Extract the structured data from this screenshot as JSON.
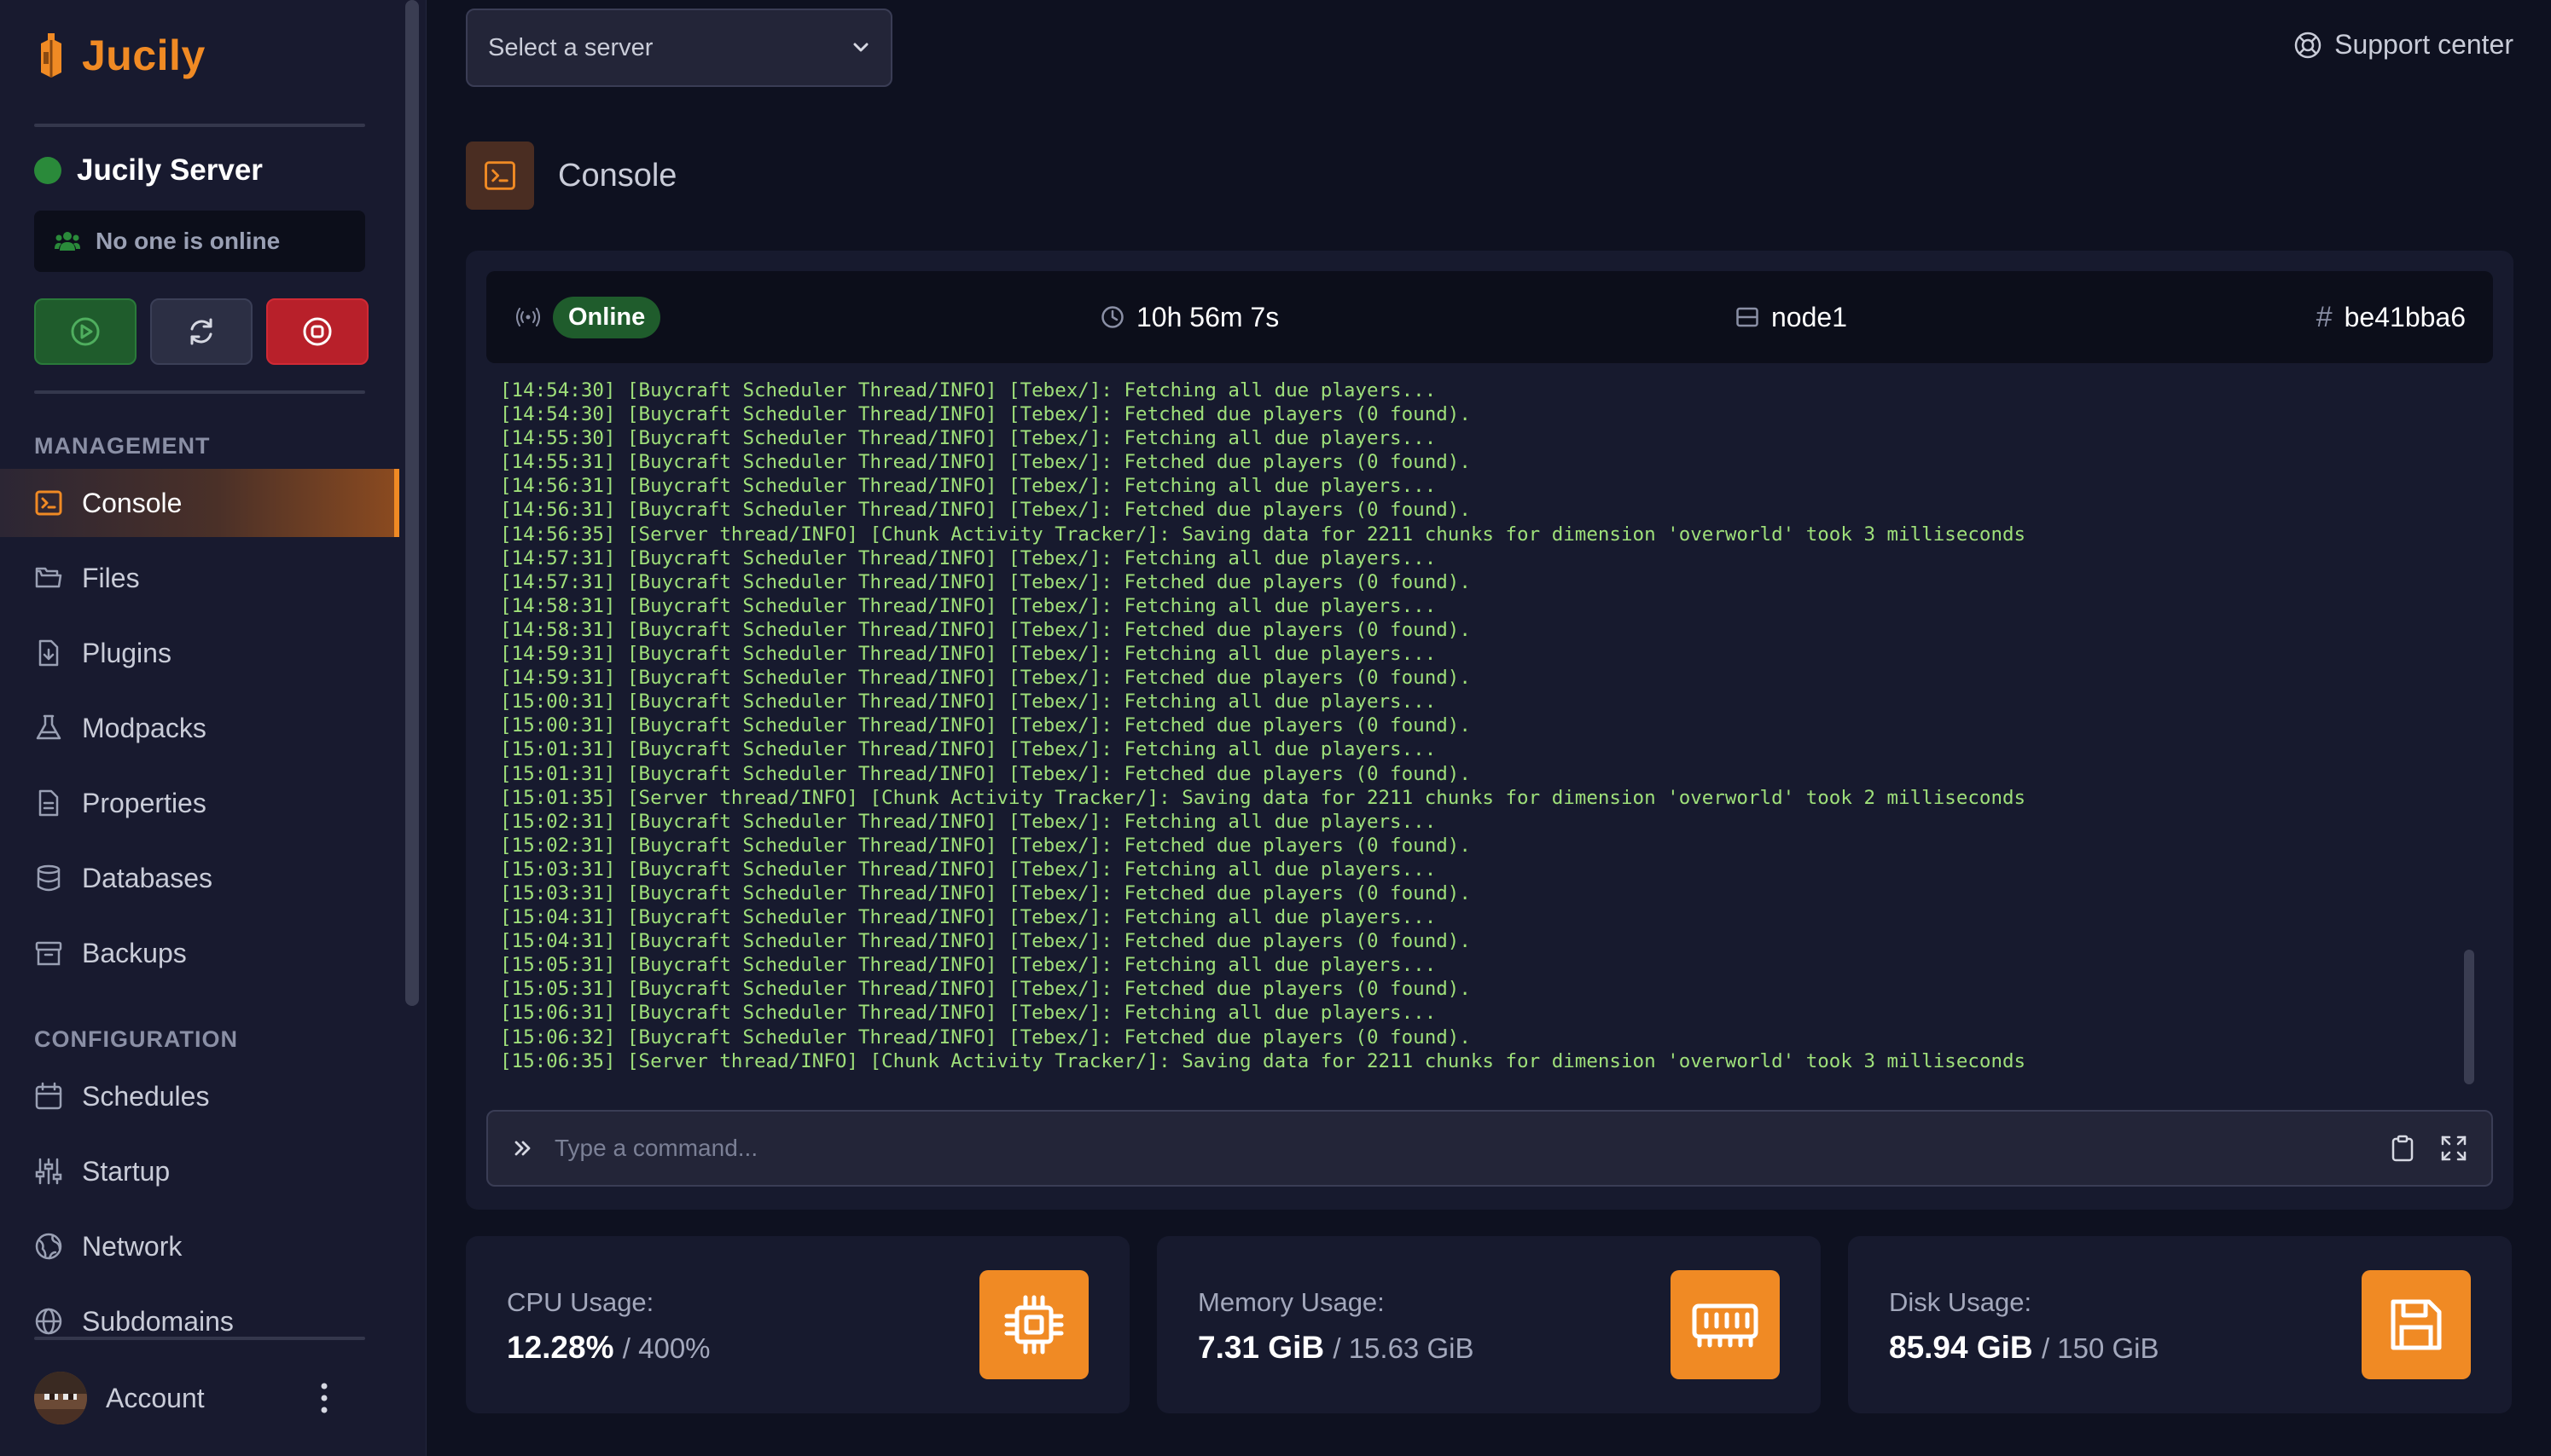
{
  "app": {
    "name": "Jucily"
  },
  "server": {
    "name": "Jucily Server",
    "players_text": "No one is online"
  },
  "top": {
    "select_placeholder": "Select a server",
    "support_label": "Support center"
  },
  "sidebar": {
    "management_label": "MANAGEMENT",
    "configuration_label": "CONFIGURATION",
    "management_items": [
      {
        "label": "Console",
        "icon": "terminal-icon",
        "active": true
      },
      {
        "label": "Files",
        "icon": "folder-icon"
      },
      {
        "label": "Plugins",
        "icon": "plugin-file-icon"
      },
      {
        "label": "Modpacks",
        "icon": "flask-icon"
      },
      {
        "label": "Properties",
        "icon": "document-icon"
      },
      {
        "label": "Databases",
        "icon": "database-icon"
      },
      {
        "label": "Backups",
        "icon": "archive-icon"
      }
    ],
    "configuration_items": [
      {
        "label": "Schedules",
        "icon": "calendar-icon"
      },
      {
        "label": "Startup",
        "icon": "sliders-icon"
      },
      {
        "label": "Network",
        "icon": "network-globe-icon"
      },
      {
        "label": "Subdomains",
        "icon": "globe-icon"
      }
    ],
    "account_label": "Account"
  },
  "page": {
    "title": "Console"
  },
  "console": {
    "status": "Online",
    "uptime": "10h 56m 7s",
    "node": "node1",
    "id_hash": "#",
    "id": "be41bba6",
    "command_placeholder": "Type a command...",
    "lines": [
      "[14:54:30] [Buycraft Scheduler Thread/INFO] [Tebex/]: Fetching all due players...",
      "[14:54:30] [Buycraft Scheduler Thread/INFO] [Tebex/]: Fetched due players (0 found).",
      "[14:55:30] [Buycraft Scheduler Thread/INFO] [Tebex/]: Fetching all due players...",
      "[14:55:31] [Buycraft Scheduler Thread/INFO] [Tebex/]: Fetched due players (0 found).",
      "[14:56:31] [Buycraft Scheduler Thread/INFO] [Tebex/]: Fetching all due players...",
      "[14:56:31] [Buycraft Scheduler Thread/INFO] [Tebex/]: Fetched due players (0 found).",
      "[14:56:35] [Server thread/INFO] [Chunk Activity Tracker/]: Saving data for 2211 chunks for dimension 'overworld' took 3 milliseconds",
      "[14:57:31] [Buycraft Scheduler Thread/INFO] [Tebex/]: Fetching all due players...",
      "[14:57:31] [Buycraft Scheduler Thread/INFO] [Tebex/]: Fetched due players (0 found).",
      "[14:58:31] [Buycraft Scheduler Thread/INFO] [Tebex/]: Fetching all due players...",
      "[14:58:31] [Buycraft Scheduler Thread/INFO] [Tebex/]: Fetched due players (0 found).",
      "[14:59:31] [Buycraft Scheduler Thread/INFO] [Tebex/]: Fetching all due players...",
      "[14:59:31] [Buycraft Scheduler Thread/INFO] [Tebex/]: Fetched due players (0 found).",
      "[15:00:31] [Buycraft Scheduler Thread/INFO] [Tebex/]: Fetching all due players...",
      "[15:00:31] [Buycraft Scheduler Thread/INFO] [Tebex/]: Fetched due players (0 found).",
      "[15:01:31] [Buycraft Scheduler Thread/INFO] [Tebex/]: Fetching all due players...",
      "[15:01:31] [Buycraft Scheduler Thread/INFO] [Tebex/]: Fetched due players (0 found).",
      "[15:01:35] [Server thread/INFO] [Chunk Activity Tracker/]: Saving data for 2211 chunks for dimension 'overworld' took 2 milliseconds",
      "[15:02:31] [Buycraft Scheduler Thread/INFO] [Tebex/]: Fetching all due players...",
      "[15:02:31] [Buycraft Scheduler Thread/INFO] [Tebex/]: Fetched due players (0 found).",
      "[15:03:31] [Buycraft Scheduler Thread/INFO] [Tebex/]: Fetching all due players...",
      "[15:03:31] [Buycraft Scheduler Thread/INFO] [Tebex/]: Fetched due players (0 found).",
      "[15:04:31] [Buycraft Scheduler Thread/INFO] [Tebex/]: Fetching all due players...",
      "[15:04:31] [Buycraft Scheduler Thread/INFO] [Tebex/]: Fetched due players (0 found).",
      "[15:05:31] [Buycraft Scheduler Thread/INFO] [Tebex/]: Fetching all due players...",
      "[15:05:31] [Buycraft Scheduler Thread/INFO] [Tebex/]: Fetched due players (0 found).",
      "[15:06:31] [Buycraft Scheduler Thread/INFO] [Tebex/]: Fetching all due players...",
      "[15:06:32] [Buycraft Scheduler Thread/INFO] [Tebex/]: Fetched due players (0 found).",
      "[15:06:35] [Server thread/INFO] [Chunk Activity Tracker/]: Saving data for 2211 chunks for dimension 'overworld' took 3 milliseconds"
    ]
  },
  "stats": {
    "cpu": {
      "label": "CPU Usage:",
      "value": "12.28%",
      "max": "/ 400%",
      "icon": "cpu-chip-icon"
    },
    "memory": {
      "label": "Memory Usage:",
      "value": "7.31 GiB",
      "max": "/ 15.63 GiB",
      "icon": "memory-stick-icon"
    },
    "disk": {
      "label": "Disk Usage:",
      "value": "85.94 GiB",
      "max": "/ 150 GiB",
      "icon": "floppy-disk-icon"
    }
  },
  "colors": {
    "accent": "#f08a24",
    "background": "#0e1120",
    "sidebar": "#181a2f",
    "online": "#1f5c2c",
    "log_text": "#9fe07a",
    "stop": "#b8202a"
  }
}
